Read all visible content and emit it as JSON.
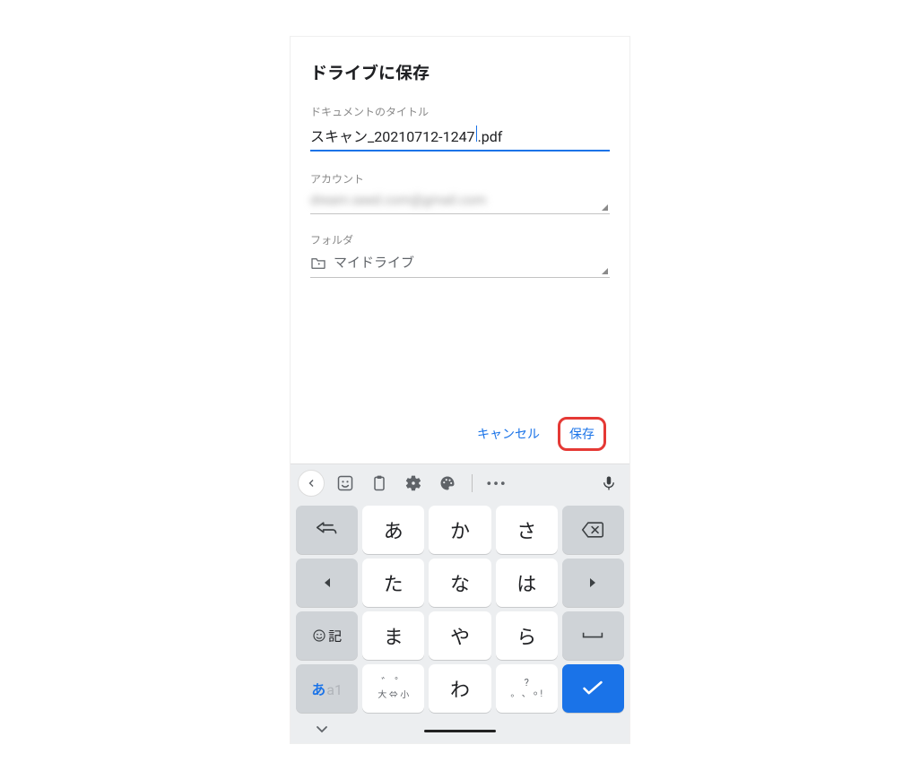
{
  "dialog": {
    "title": "ドライブに保存",
    "fields": {
      "documentTitle": {
        "label": "ドキュメントのタイトル",
        "value_prefix": "スキャン_20210712-1247",
        "value_suffix": ".pdf"
      },
      "account": {
        "label": "アカウント",
        "value": "dream.seed.com@gmail.com"
      },
      "folder": {
        "label": "フォルダ",
        "value": "マイドライブ"
      }
    },
    "actions": {
      "cancel": "キャンセル",
      "save": "保存"
    }
  },
  "keyboard": {
    "toolbar": {
      "back_icon": "chevron-left",
      "sticker_icon": "sticker",
      "clipboard_icon": "clipboard",
      "settings_icon": "gear",
      "palette_icon": "palette",
      "more_icon": "more",
      "mic_icon": "mic"
    },
    "rows": [
      [
        {
          "type": "icon",
          "name": "undo-icon",
          "style": "gray"
        },
        {
          "type": "char",
          "label": "あ"
        },
        {
          "type": "char",
          "label": "か"
        },
        {
          "type": "char",
          "label": "さ"
        },
        {
          "type": "icon",
          "name": "backspace-icon",
          "style": "gray"
        }
      ],
      [
        {
          "type": "icon",
          "name": "arrow-left-icon",
          "style": "gray"
        },
        {
          "type": "char",
          "label": "た"
        },
        {
          "type": "char",
          "label": "な"
        },
        {
          "type": "char",
          "label": "は"
        },
        {
          "type": "icon",
          "name": "arrow-right-icon",
          "style": "gray"
        }
      ],
      [
        {
          "type": "emoji",
          "label": "☺記",
          "style": "gray"
        },
        {
          "type": "char",
          "label": "ま"
        },
        {
          "type": "char",
          "label": "や"
        },
        {
          "type": "char",
          "label": "ら"
        },
        {
          "type": "icon",
          "name": "space-icon",
          "style": "gray"
        }
      ],
      [
        {
          "type": "mode",
          "active": "あ",
          "inactive": "a1",
          "style": "gray"
        },
        {
          "type": "diacritic",
          "top": "゛ ゜",
          "bottom": "大 ⇔ 小"
        },
        {
          "type": "char",
          "label": "わ"
        },
        {
          "type": "punct",
          "top": "?",
          "bottom": "。 、 ⸰ !"
        },
        {
          "type": "icon",
          "name": "check-icon",
          "style": "blue"
        }
      ]
    ]
  }
}
